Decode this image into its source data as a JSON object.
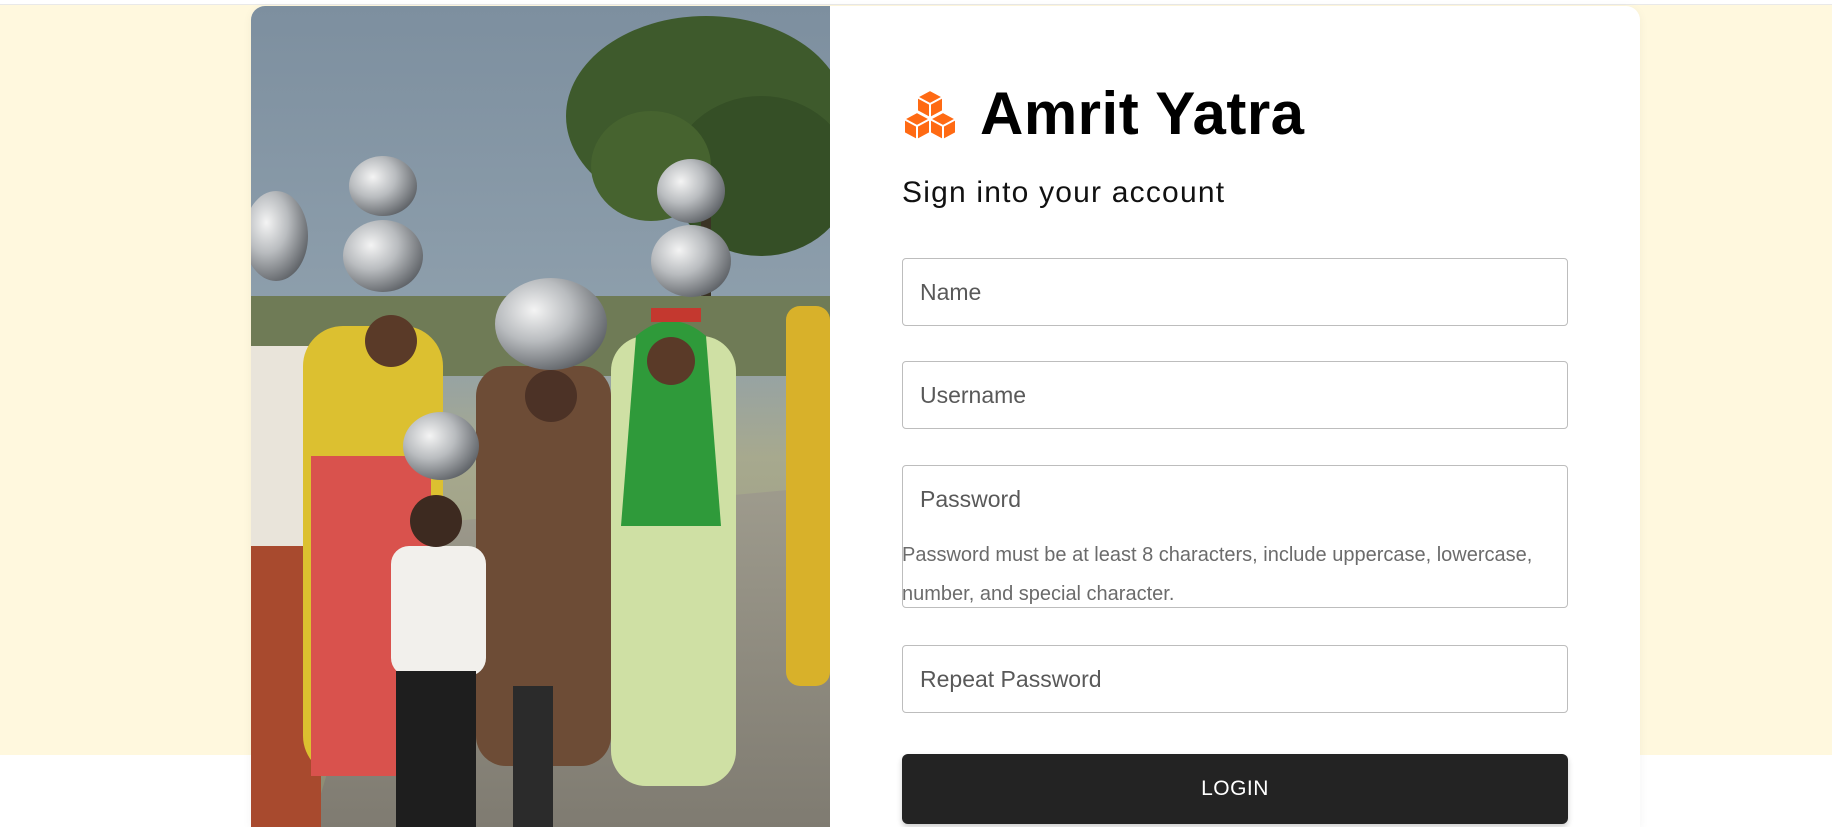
{
  "brand": {
    "name": "Amrit Yatra",
    "icon": "cubes-icon",
    "accent_color": "#ff6a13"
  },
  "form": {
    "title": "Sign into your account",
    "name_placeholder": "Name",
    "username_placeholder": "Username",
    "password_placeholder": "Password",
    "password_hint": "Password must be at least 8 characters, include uppercase, lowercase, number, and special character.",
    "repeat_password_placeholder": "Repeat Password",
    "login_label": "LOGIN"
  },
  "colors": {
    "page_background": "#fff8de",
    "card_background": "#ffffff",
    "button_background": "#232323",
    "button_text": "#ffffff"
  }
}
